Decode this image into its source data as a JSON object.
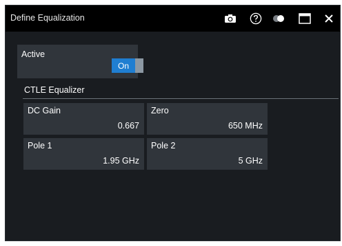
{
  "window": {
    "title": "Define Equalization"
  },
  "titlebar_icons": [
    "camera-icon",
    "help-icon",
    "toggle-icon",
    "maximize-icon",
    "close-icon"
  ],
  "active": {
    "label": "Active",
    "state": "On"
  },
  "ctle": {
    "group_label": "CTLE Equalizer",
    "fields": [
      {
        "label": "DC Gain",
        "value": "0.667"
      },
      {
        "label": "Zero",
        "value": "650 MHz"
      },
      {
        "label": "Pole 1",
        "value": "1.95 GHz"
      },
      {
        "label": "Pole 2",
        "value": "5 GHz"
      }
    ]
  },
  "colors": {
    "window_bg": "#191c20",
    "titlebar_bg": "#000000",
    "panel_bg": "#30353b",
    "accent": "#1f7ed1"
  }
}
